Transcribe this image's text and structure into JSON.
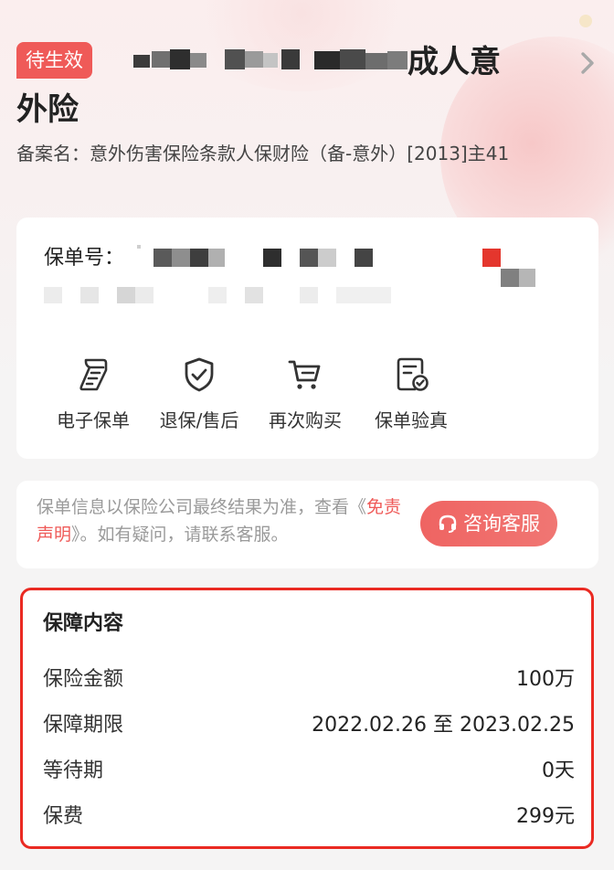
{
  "header": {
    "status_badge": "待生效",
    "title_line1_tail": "成人意",
    "title_line2": "外险",
    "filing_name": "备案名：意外伤害保险条款人保财险（备-意外）[2013]主41"
  },
  "policy": {
    "number_label": "保单号："
  },
  "actions": [
    {
      "label": "电子保单",
      "icon": "receipt-icon"
    },
    {
      "label": "退保/售后",
      "icon": "shield-check-icon"
    },
    {
      "label": "再次购买",
      "icon": "cart-icon"
    },
    {
      "label": "保单验真",
      "icon": "document-verify-icon"
    }
  ],
  "notice": {
    "text_before": "保单信息以保险公司最终结果为准，查看《",
    "link": "免责声明",
    "text_after": "》。如有疑问，请联系客服。",
    "service_button": "咨询客服"
  },
  "coverage": {
    "title": "保障内容",
    "rows": [
      {
        "label": "保险金额",
        "value": "100万"
      },
      {
        "label": "保障期限",
        "value": "2022.02.26 至 2023.02.25"
      },
      {
        "label": "等待期",
        "value": "0天"
      },
      {
        "label": "保费",
        "value": "299元"
      }
    ]
  },
  "colors": {
    "accent": "#ef5a58",
    "highlight_border": "#ea2a22"
  }
}
